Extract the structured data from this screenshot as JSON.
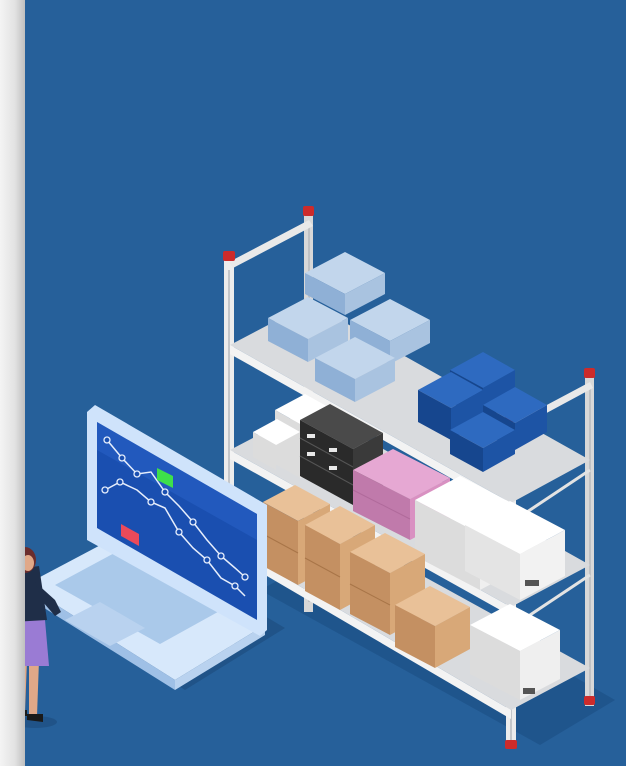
{
  "scene": {
    "subject": "isometric-warehouse-shelving-with-laptop-analytics",
    "colors": {
      "background": "#26609a",
      "shelf_frame": "#e6e6e6",
      "shelf_accent": "#cc2b2b",
      "light_blue_box": "#a9c3e0",
      "dark_blue_box": "#1d54a5",
      "white_box": "#f2f2f2",
      "black_box": "#3a3a3a",
      "pink_box": "#d991c2",
      "cardboard_box": "#d8a878",
      "laptop_body": "#cfe3fb",
      "laptop_screen": "#1a4fb0",
      "chart_flag_green": "#3ee04a",
      "chart_flag_red": "#ea4a5a",
      "person_jacket": "#1f2e48",
      "person_skirt": "#9a7bd4",
      "person_hair": "#6a2d2d"
    },
    "icons": [
      "shelving-unit",
      "laptop-icon",
      "line-chart-icon",
      "person-figure",
      "boxes"
    ]
  }
}
